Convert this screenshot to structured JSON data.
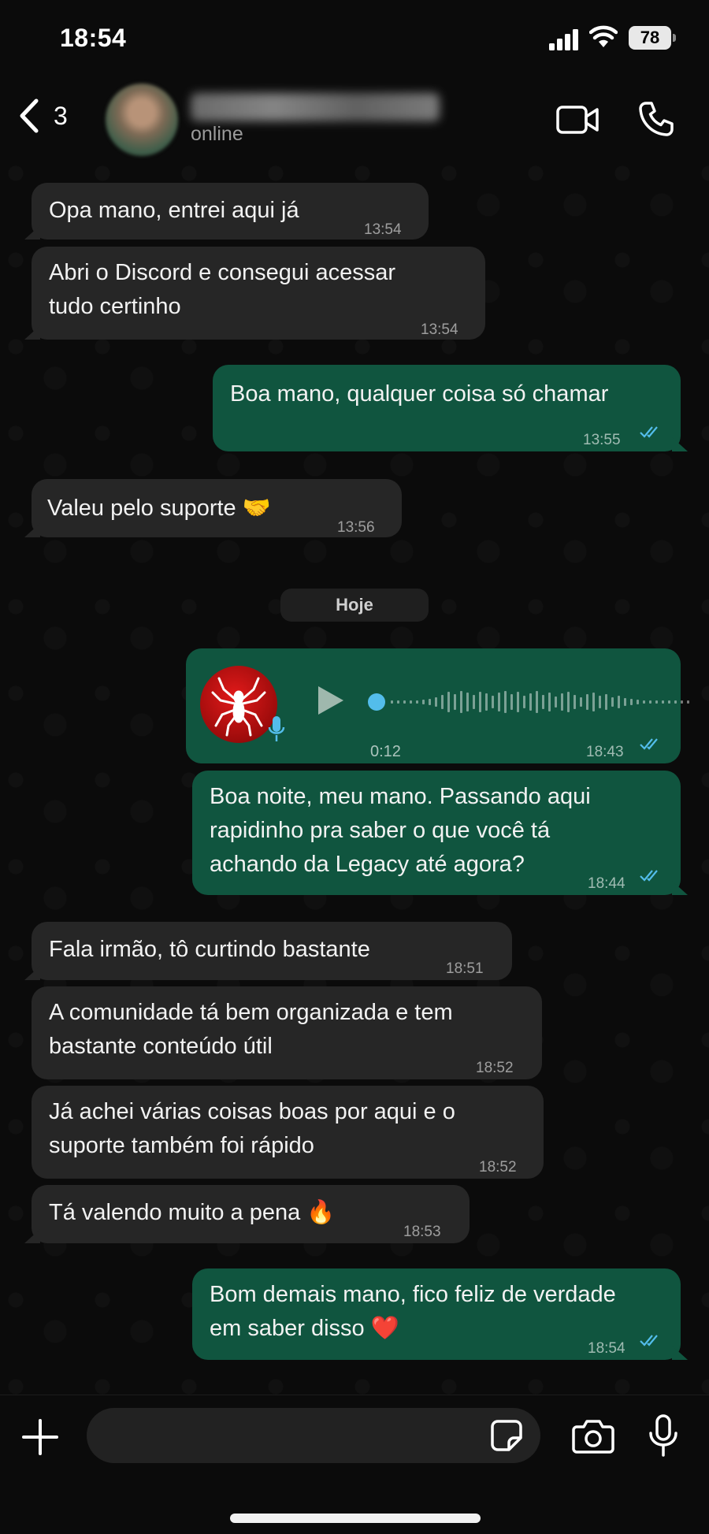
{
  "status_bar": {
    "time": "18:54",
    "battery": "78"
  },
  "header": {
    "back_count": "3",
    "contact_status": "online"
  },
  "date_divider": "Hoje",
  "messages": [
    {
      "dir": "in",
      "text": "Opa mano, entrei aqui já",
      "time": "13:54"
    },
    {
      "dir": "in",
      "text": "Abri o Discord e consegui acessar\ntudo certinho",
      "time": "13:54"
    },
    {
      "dir": "out",
      "text": "Boa mano, qualquer coisa só chamar",
      "time": "13:55"
    },
    {
      "dir": "in",
      "text": "Valeu pelo suporte 🤝",
      "time": "13:56"
    },
    {
      "dir": "out",
      "type": "voice",
      "duration": "0:12",
      "time": "18:43"
    },
    {
      "dir": "out",
      "text": "Boa noite, meu mano. Passando aqui\nrapidinho pra saber o que você tá\nachando da Legacy até agora?",
      "time": "18:44"
    },
    {
      "dir": "in",
      "text": "Fala irmão, tô curtindo bastante",
      "time": "18:51"
    },
    {
      "dir": "in",
      "text": "A comunidade tá bem organizada e tem\nbastante conteúdo útil",
      "time": "18:52"
    },
    {
      "dir": "in",
      "text": "Já achei várias coisas boas por aqui e o\nsuporte também foi rápido",
      "time": "18:52"
    },
    {
      "dir": "in",
      "text": "Tá valendo muito a pena 🔥",
      "time": "18:53"
    },
    {
      "dir": "out",
      "text": "Bom demais mano, fico feliz de verdade\nem saber disso ❤️",
      "time": "18:54"
    }
  ],
  "colors": {
    "incoming_bubble": "#262626",
    "outgoing_bubble": "#10553f",
    "read_ticks": "#53bdeb",
    "voice_dot": "#53bdeb"
  },
  "icons": [
    "back-chevron-icon",
    "video-call-icon",
    "phone-icon",
    "play-icon",
    "mic-icon",
    "plus-icon",
    "sticker-icon",
    "camera-icon",
    "spider-icon"
  ]
}
